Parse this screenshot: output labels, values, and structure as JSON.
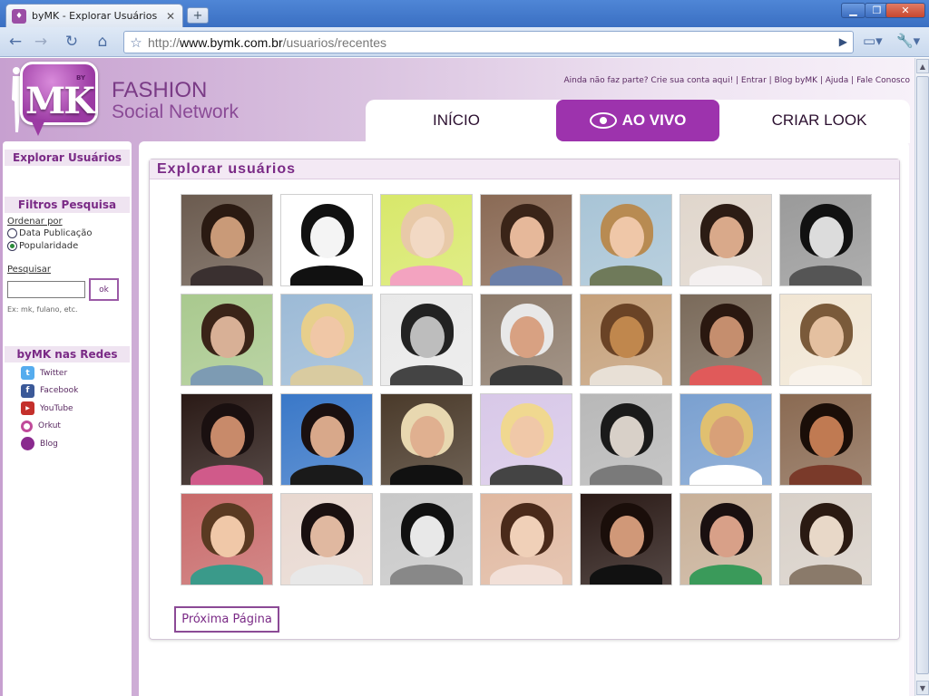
{
  "browser": {
    "tab_title": "byMK - Explorar Usuários",
    "tab_favicon": "mk-favicon",
    "url_prefix": "http://",
    "url_host": "www.bymk.com.br",
    "url_path": "/usuarios/recentes"
  },
  "header": {
    "brand_line1": "FASHION",
    "brand_line2": "Social Network",
    "logo_text": "MK",
    "logo_by": "BY",
    "toplinks": "Ainda não faz parte? Crie sua conta aqui! | Entrar | Blog byMK | Ajuda | Fale Conosco"
  },
  "nav": {
    "items": [
      {
        "label": "INÍCIO"
      },
      {
        "label": "AO VIVO"
      },
      {
        "label": "CRIAR LOOK"
      }
    ],
    "accent": "#9d33ad"
  },
  "sidebar": {
    "explore_title": "Explorar Usuários",
    "filters_title": "Filtros Pesquisa",
    "order_label": "Ordenar por",
    "order_options": [
      {
        "label": "Data Publicação",
        "checked": false
      },
      {
        "label": "Popularidade",
        "checked": true
      }
    ],
    "search_label": "Pesquisar",
    "search_value": "",
    "ok_label": "ok",
    "search_hint": "Ex: mk, fulano, etc.",
    "social_title": "byMK nas Redes",
    "social": [
      {
        "label": "Twitter",
        "icon": "twitter-icon"
      },
      {
        "label": "Facebook",
        "icon": "facebook-icon"
      },
      {
        "label": "YouTube",
        "icon": "youtube-icon"
      },
      {
        "label": "Orkut",
        "icon": "orkut-icon"
      },
      {
        "label": "Blog",
        "icon": "blog-icon"
      }
    ]
  },
  "main": {
    "title": "Explorar usuários",
    "next_label": "Próxima Página",
    "photos": [
      {
        "bg": "#6b5b4f",
        "hair": "#2a1a12",
        "skin": "#c99a78",
        "top": "#3a3030"
      },
      {
        "bg": "#ffffff",
        "hair": "#111111",
        "skin": "#f4f4f4",
        "top": "#111111"
      },
      {
        "bg": "#d8e86a",
        "hair": "#e8c9a8",
        "skin": "#f2d9c4",
        "top": "#f3a3c0"
      },
      {
        "bg": "#8a6a55",
        "hair": "#3a2418",
        "skin": "#e6b89a",
        "top": "#6b7fa8"
      },
      {
        "bg": "#a8c4d6",
        "hair": "#b88b52",
        "skin": "#efc7a8",
        "top": "#6f7a5a"
      },
      {
        "bg": "#e0d6cc",
        "hair": "#2c1c14",
        "skin": "#d9a98a",
        "top": "#f4f0f0"
      },
      {
        "bg": "#9a9a9a",
        "hair": "#111111",
        "skin": "#dcdcdc",
        "top": "#555555"
      },
      {
        "bg": "#a9c98e",
        "hair": "#3a2418",
        "skin": "#d8b096",
        "top": "#7d9bb3"
      },
      {
        "bg": "#9cbad6",
        "hair": "#e7cf8c",
        "skin": "#f0c7a6",
        "top": "#d9cba0"
      },
      {
        "bg": "#e9e9e9",
        "hair": "#222222",
        "skin": "#bdbdbd",
        "top": "#444444"
      },
      {
        "bg": "#8c7a6a",
        "hair": "#e8e8e8",
        "skin": "#d8a182",
        "top": "#3a3a3a"
      },
      {
        "bg": "#c5a07a",
        "hair": "#6a4326",
        "skin": "#c0874d",
        "top": "#e8e0d6"
      },
      {
        "bg": "#7a6a5a",
        "hair": "#2a1810",
        "skin": "#c58e6e",
        "top": "#e05a5a"
      },
      {
        "bg": "#f1e6d4",
        "hair": "#7a5a3a",
        "skin": "#e4c0a0",
        "top": "#f8f2ea"
      },
      {
        "bg": "#2a1a16",
        "hair": "#1a1010",
        "skin": "#c88a6a",
        "top": "#d05a8a"
      },
      {
        "bg": "#3a78c8",
        "hair": "#1a1010",
        "skin": "#d8a88a",
        "top": "#1a1a1a"
      },
      {
        "bg": "#4a3a2a",
        "hair": "#e8d8b0",
        "skin": "#e0b090",
        "top": "#111111"
      },
      {
        "bg": "#d8c8e8",
        "hair": "#f0d890",
        "skin": "#f0c8a8",
        "top": "#444444"
      },
      {
        "bg": "#b8b8b8",
        "hair": "#1a1a1a",
        "skin": "#d8d0c8",
        "top": "#7a7a7a"
      },
      {
        "bg": "#7aa0d0",
        "hair": "#e0c070",
        "skin": "#d8a078",
        "top": "#ffffff"
      },
      {
        "bg": "#8a6a52",
        "hair": "#1a0e08",
        "skin": "#c07a52",
        "top": "#7a3a2a"
      },
      {
        "bg": "#c86a6a",
        "hair": "#5a3a22",
        "skin": "#f0c8a8",
        "top": "#3a9a8a"
      },
      {
        "bg": "#e8d8d0",
        "hair": "#1a1010",
        "skin": "#e0b8a0",
        "top": "#e8e8e8"
      },
      {
        "bg": "#c8c8c8",
        "hair": "#111111",
        "skin": "#e8e8e8",
        "top": "#888888"
      },
      {
        "bg": "#e0b8a0",
        "hair": "#4a2a1a",
        "skin": "#f0d0b8",
        "top": "#f2e0d8"
      },
      {
        "bg": "#2a1a16",
        "hair": "#1a0e0a",
        "skin": "#d09878",
        "top": "#111111"
      },
      {
        "bg": "#c8b098",
        "hair": "#1a1010",
        "skin": "#d8a088",
        "top": "#3a9a5a"
      },
      {
        "bg": "#d8d0c8",
        "hair": "#2a1a12",
        "skin": "#e8d8c8",
        "top": "#8a7a6a"
      }
    ]
  }
}
